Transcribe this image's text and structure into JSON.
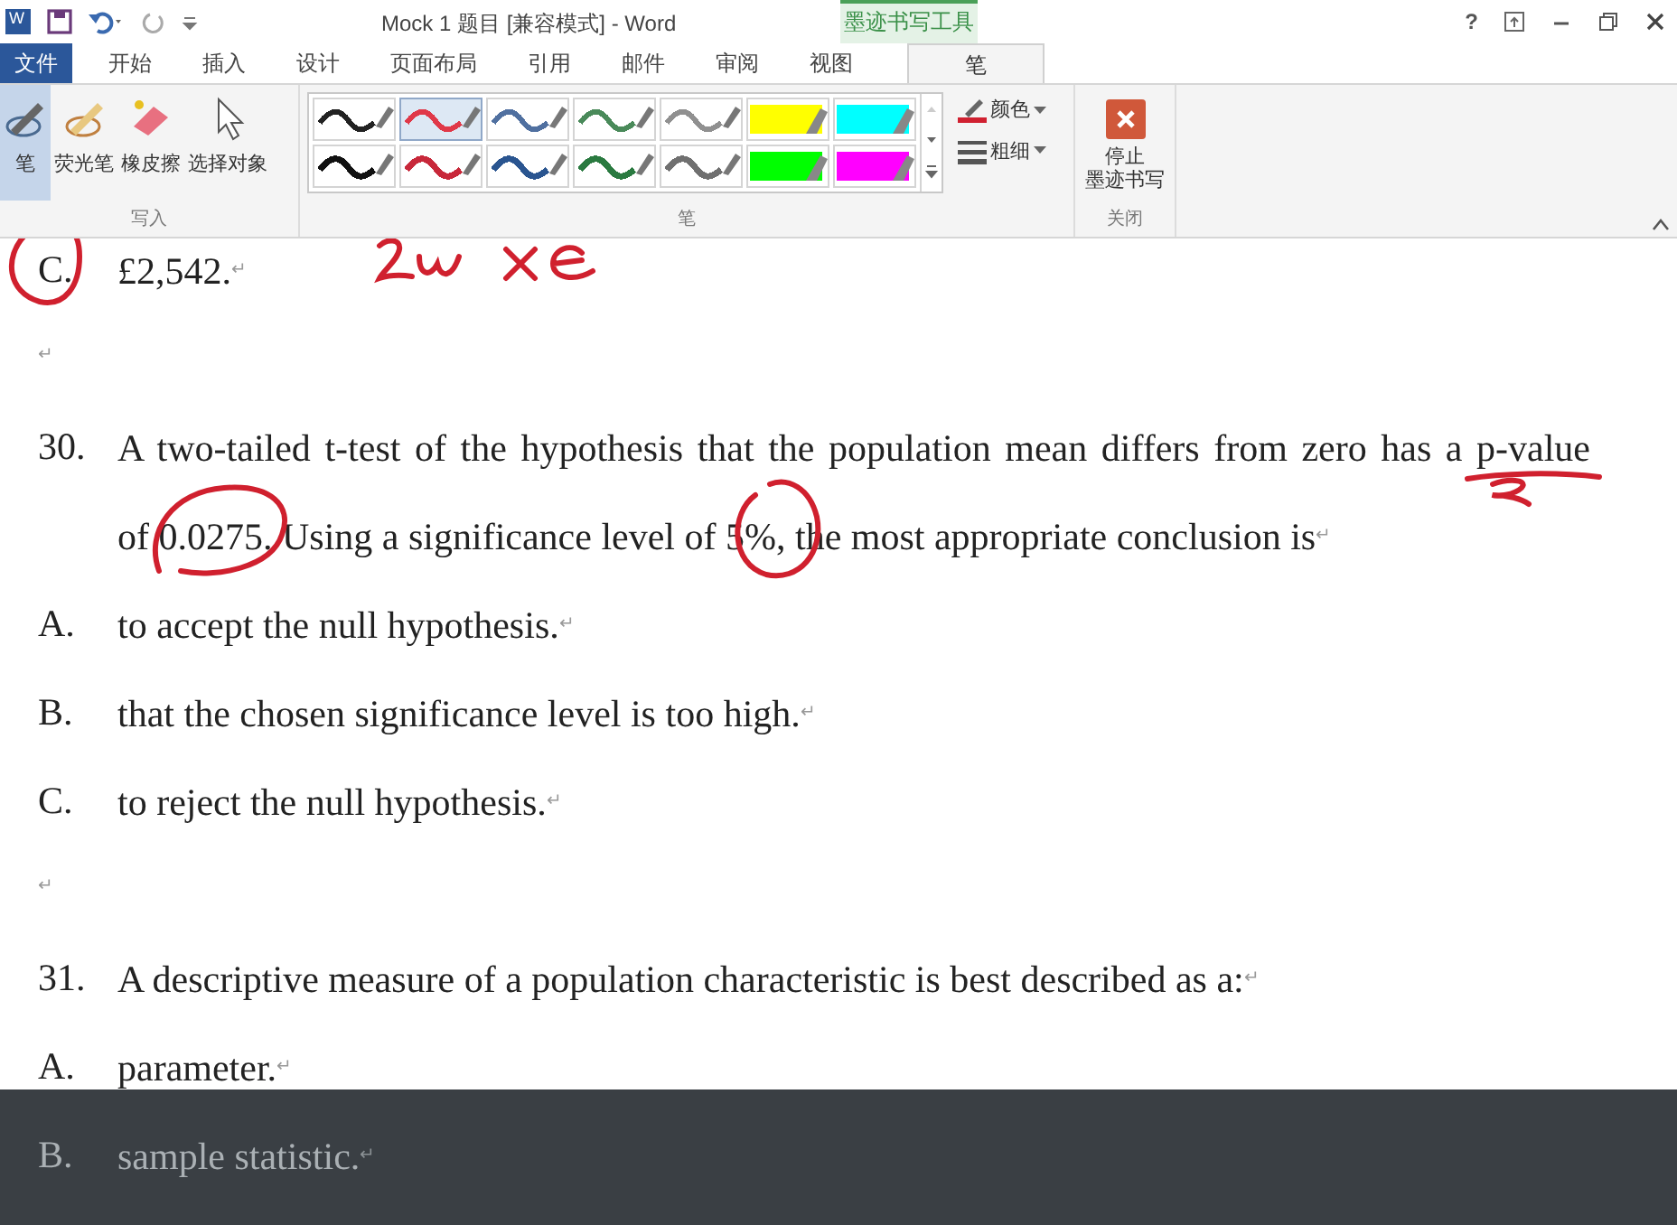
{
  "title_bar": {
    "title": "Mock 1 题目 [兼容模式] - Word",
    "contextual_group": "墨迹书写工具",
    "help": "?",
    "app_icon": "W"
  },
  "tabs": [
    {
      "label": "文件",
      "kind": "file",
      "selected": false
    },
    {
      "label": "开始",
      "kind": "tab",
      "selected": false
    },
    {
      "label": "插入",
      "kind": "tab",
      "selected": false
    },
    {
      "label": "设计",
      "kind": "tab",
      "selected": false
    },
    {
      "label": "页面布局",
      "kind": "tab",
      "selected": false
    },
    {
      "label": "引用",
      "kind": "tab",
      "selected": false
    },
    {
      "label": "邮件",
      "kind": "tab",
      "selected": false
    },
    {
      "label": "审阅",
      "kind": "tab",
      "selected": false
    },
    {
      "label": "视图",
      "kind": "tab",
      "selected": false
    },
    {
      "label": "笔",
      "kind": "contextual",
      "selected": true
    }
  ],
  "ribbon": {
    "write_group": {
      "label": "写入",
      "tools": [
        {
          "label": "笔",
          "kind": "pen",
          "selected": true
        },
        {
          "label": "荧光笔",
          "kind": "highlighter",
          "selected": false
        },
        {
          "label": "橡皮擦",
          "kind": "eraser",
          "selected": false
        },
        {
          "label": "选择对象",
          "kind": "select",
          "selected": false
        }
      ]
    },
    "pen_group": {
      "label": "笔",
      "pens": [
        {
          "kind": "thin",
          "color": "#222222",
          "selected": false
        },
        {
          "kind": "thin",
          "color": "#e03848",
          "selected": true
        },
        {
          "kind": "thin",
          "color": "#5070a0",
          "selected": false
        },
        {
          "kind": "thin",
          "color": "#4a8a5a",
          "selected": false
        },
        {
          "kind": "thin",
          "color": "#909090",
          "selected": false
        },
        {
          "kind": "highlighter",
          "color": "#ffff00",
          "selected": false
        },
        {
          "kind": "highlighter",
          "color": "#00ffff",
          "selected": false
        },
        {
          "kind": "thick",
          "color": "#111111",
          "selected": false
        },
        {
          "kind": "thick",
          "color": "#c8283a",
          "selected": false
        },
        {
          "kind": "thick",
          "color": "#2a5590",
          "selected": false
        },
        {
          "kind": "thick",
          "color": "#2a7a40",
          "selected": false
        },
        {
          "kind": "thick",
          "color": "#707070",
          "selected": false
        },
        {
          "kind": "highlighter",
          "color": "#00ff00",
          "selected": false
        },
        {
          "kind": "highlighter",
          "color": "#ff00ff",
          "selected": false
        }
      ],
      "color_button": "颜色",
      "thickness_button": "粗细"
    },
    "close_group": {
      "label": "关闭",
      "stop_button": [
        "停止",
        "墨迹书写"
      ]
    }
  },
  "document": [
    {
      "kind": "option",
      "number": "C.",
      "text": "£2,542.",
      "mark": "↵",
      "dimmed": false
    },
    {
      "kind": "empty",
      "mark": "↵",
      "dimmed": false
    },
    {
      "kind": "question",
      "number": "30.",
      "lines": [
        "A two-tailed t-test of the hypothesis that the population mean differs from zero has a p-value",
        "of 0.0275. Using a significance level of 5%, the most appropriate conclusion is"
      ],
      "mark": "↵",
      "dimmed": false
    },
    {
      "kind": "option",
      "number": "A.",
      "text": "to accept the null hypothesis.",
      "mark": "↵",
      "dimmed": false
    },
    {
      "kind": "option",
      "number": "B.",
      "text": "that the chosen significance level is too high.",
      "mark": "↵",
      "dimmed": false
    },
    {
      "kind": "option",
      "number": "C.",
      "text": "to reject the null hypothesis.",
      "mark": "↵",
      "dimmed": false
    },
    {
      "kind": "empty",
      "mark": "↵",
      "dimmed": false
    },
    {
      "kind": "question",
      "number": "31.",
      "lines": [
        "A descriptive measure of a population characteristic is best described as a:"
      ],
      "mark": "↵",
      "dimmed": false
    },
    {
      "kind": "option",
      "number": "A.",
      "text": "parameter.",
      "mark": "↵",
      "dimmed": false
    },
    {
      "kind": "option",
      "number": "B.",
      "text": "sample statistic.",
      "mark": "↵",
      "dimmed": true
    }
  ]
}
